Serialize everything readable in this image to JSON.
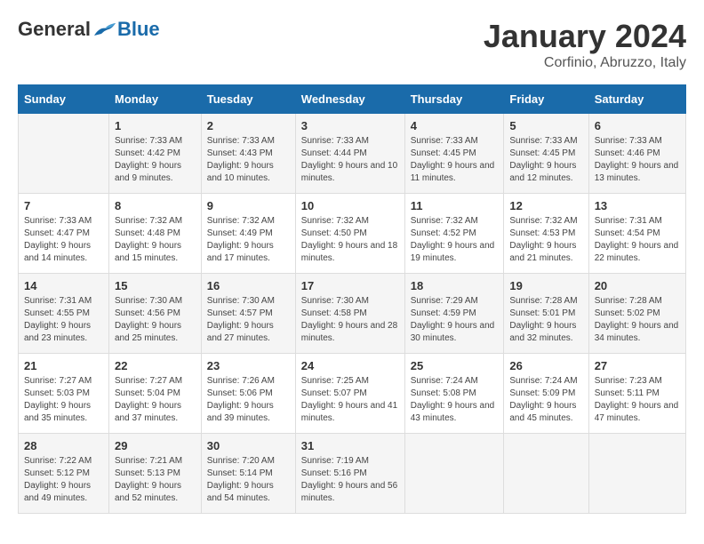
{
  "header": {
    "logo_general": "General",
    "logo_blue": "Blue",
    "month_title": "January 2024",
    "location": "Corfinio, Abruzzo, Italy"
  },
  "weekdays": [
    "Sunday",
    "Monday",
    "Tuesday",
    "Wednesday",
    "Thursday",
    "Friday",
    "Saturday"
  ],
  "weeks": [
    [
      {
        "day": "",
        "info": ""
      },
      {
        "day": "1",
        "info": "Sunrise: 7:33 AM\nSunset: 4:42 PM\nDaylight: 9 hours\nand 9 minutes."
      },
      {
        "day": "2",
        "info": "Sunrise: 7:33 AM\nSunset: 4:43 PM\nDaylight: 9 hours\nand 10 minutes."
      },
      {
        "day": "3",
        "info": "Sunrise: 7:33 AM\nSunset: 4:44 PM\nDaylight: 9 hours\nand 10 minutes."
      },
      {
        "day": "4",
        "info": "Sunrise: 7:33 AM\nSunset: 4:45 PM\nDaylight: 9 hours\nand 11 minutes."
      },
      {
        "day": "5",
        "info": "Sunrise: 7:33 AM\nSunset: 4:45 PM\nDaylight: 9 hours\nand 12 minutes."
      },
      {
        "day": "6",
        "info": "Sunrise: 7:33 AM\nSunset: 4:46 PM\nDaylight: 9 hours\nand 13 minutes."
      }
    ],
    [
      {
        "day": "7",
        "info": "Sunrise: 7:33 AM\nSunset: 4:47 PM\nDaylight: 9 hours\nand 14 minutes."
      },
      {
        "day": "8",
        "info": "Sunrise: 7:32 AM\nSunset: 4:48 PM\nDaylight: 9 hours\nand 15 minutes."
      },
      {
        "day": "9",
        "info": "Sunrise: 7:32 AM\nSunset: 4:49 PM\nDaylight: 9 hours\nand 17 minutes."
      },
      {
        "day": "10",
        "info": "Sunrise: 7:32 AM\nSunset: 4:50 PM\nDaylight: 9 hours\nand 18 minutes."
      },
      {
        "day": "11",
        "info": "Sunrise: 7:32 AM\nSunset: 4:52 PM\nDaylight: 9 hours\nand 19 minutes."
      },
      {
        "day": "12",
        "info": "Sunrise: 7:32 AM\nSunset: 4:53 PM\nDaylight: 9 hours\nand 21 minutes."
      },
      {
        "day": "13",
        "info": "Sunrise: 7:31 AM\nSunset: 4:54 PM\nDaylight: 9 hours\nand 22 minutes."
      }
    ],
    [
      {
        "day": "14",
        "info": "Sunrise: 7:31 AM\nSunset: 4:55 PM\nDaylight: 9 hours\nand 23 minutes."
      },
      {
        "day": "15",
        "info": "Sunrise: 7:30 AM\nSunset: 4:56 PM\nDaylight: 9 hours\nand 25 minutes."
      },
      {
        "day": "16",
        "info": "Sunrise: 7:30 AM\nSunset: 4:57 PM\nDaylight: 9 hours\nand 27 minutes."
      },
      {
        "day": "17",
        "info": "Sunrise: 7:30 AM\nSunset: 4:58 PM\nDaylight: 9 hours\nand 28 minutes."
      },
      {
        "day": "18",
        "info": "Sunrise: 7:29 AM\nSunset: 4:59 PM\nDaylight: 9 hours\nand 30 minutes."
      },
      {
        "day": "19",
        "info": "Sunrise: 7:28 AM\nSunset: 5:01 PM\nDaylight: 9 hours\nand 32 minutes."
      },
      {
        "day": "20",
        "info": "Sunrise: 7:28 AM\nSunset: 5:02 PM\nDaylight: 9 hours\nand 34 minutes."
      }
    ],
    [
      {
        "day": "21",
        "info": "Sunrise: 7:27 AM\nSunset: 5:03 PM\nDaylight: 9 hours\nand 35 minutes."
      },
      {
        "day": "22",
        "info": "Sunrise: 7:27 AM\nSunset: 5:04 PM\nDaylight: 9 hours\nand 37 minutes."
      },
      {
        "day": "23",
        "info": "Sunrise: 7:26 AM\nSunset: 5:06 PM\nDaylight: 9 hours\nand 39 minutes."
      },
      {
        "day": "24",
        "info": "Sunrise: 7:25 AM\nSunset: 5:07 PM\nDaylight: 9 hours\nand 41 minutes."
      },
      {
        "day": "25",
        "info": "Sunrise: 7:24 AM\nSunset: 5:08 PM\nDaylight: 9 hours\nand 43 minutes."
      },
      {
        "day": "26",
        "info": "Sunrise: 7:24 AM\nSunset: 5:09 PM\nDaylight: 9 hours\nand 45 minutes."
      },
      {
        "day": "27",
        "info": "Sunrise: 7:23 AM\nSunset: 5:11 PM\nDaylight: 9 hours\nand 47 minutes."
      }
    ],
    [
      {
        "day": "28",
        "info": "Sunrise: 7:22 AM\nSunset: 5:12 PM\nDaylight: 9 hours\nand 49 minutes."
      },
      {
        "day": "29",
        "info": "Sunrise: 7:21 AM\nSunset: 5:13 PM\nDaylight: 9 hours\nand 52 minutes."
      },
      {
        "day": "30",
        "info": "Sunrise: 7:20 AM\nSunset: 5:14 PM\nDaylight: 9 hours\nand 54 minutes."
      },
      {
        "day": "31",
        "info": "Sunrise: 7:19 AM\nSunset: 5:16 PM\nDaylight: 9 hours\nand 56 minutes."
      },
      {
        "day": "",
        "info": ""
      },
      {
        "day": "",
        "info": ""
      },
      {
        "day": "",
        "info": ""
      }
    ]
  ]
}
